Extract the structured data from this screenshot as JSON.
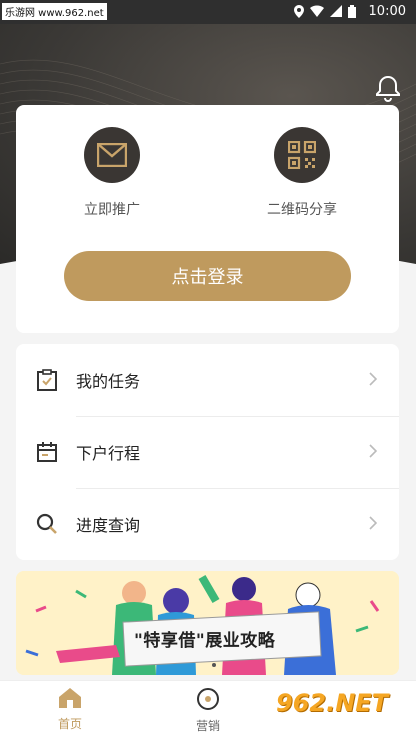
{
  "status_bar": {
    "source_label": "乐游网 www.962.net",
    "time": "10:00"
  },
  "card": {
    "actions": [
      {
        "label": "立即推广",
        "icon": "mail-icon"
      },
      {
        "label": "二维码分享",
        "icon": "qr-code-icon"
      }
    ],
    "login_label": "点击登录"
  },
  "menu": {
    "items": [
      {
        "label": "我的任务",
        "icon": "task-clipboard-icon"
      },
      {
        "label": "下户行程",
        "icon": "calendar-icon"
      },
      {
        "label": "进度查询",
        "icon": "search-icon"
      }
    ]
  },
  "banner": {
    "text": "\"特享借\"展业攻略"
  },
  "tabbar": {
    "tabs": [
      {
        "label": "首页",
        "icon": "home-icon",
        "active": true
      },
      {
        "label": "营销",
        "icon": "compass-icon",
        "active": false
      }
    ]
  },
  "watermark": "962.NET",
  "colors": {
    "accent": "#bf9a5e",
    "dark": "#3a3633"
  }
}
